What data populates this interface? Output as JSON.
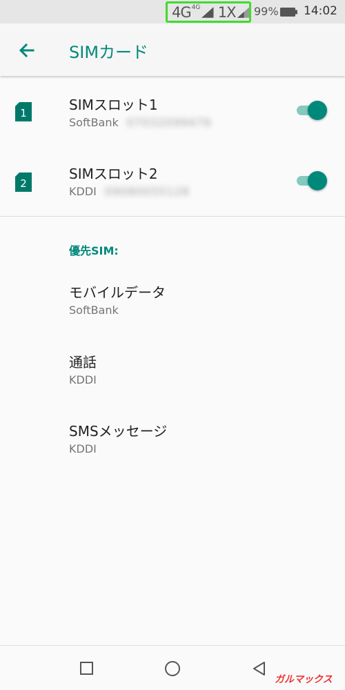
{
  "status": {
    "network_primary": "4G",
    "network_primary_sup": "4G",
    "network_secondary": "1X",
    "battery": "99%",
    "time": "14:02",
    "highlight_color": "#3fdc2b"
  },
  "app_bar": {
    "back_icon": "arrow-back-icon",
    "title": "SIMカード"
  },
  "sims": [
    {
      "slot_badge": "1",
      "name": "SIMスロット1",
      "carrier": "SoftBank",
      "number": "07032099476",
      "enabled": true
    },
    {
      "slot_badge": "2",
      "name": "SIMスロット2",
      "carrier": "KDDI",
      "number": "09080055128",
      "enabled": true
    }
  ],
  "preferred": {
    "header": "優先SIM:",
    "items": [
      {
        "title": "モバイルデータ",
        "value": "SoftBank"
      },
      {
        "title": "通話",
        "value": "KDDI"
      },
      {
        "title": "SMSメッセージ",
        "value": "KDDI"
      }
    ]
  },
  "nav": {
    "recents_icon": "square-icon",
    "home_icon": "circle-icon",
    "back_icon": "triangle-back-icon"
  },
  "watermark": "ガルマックス",
  "colors": {
    "accent": "#00897b",
    "toggle_track": "#85c9c0"
  }
}
